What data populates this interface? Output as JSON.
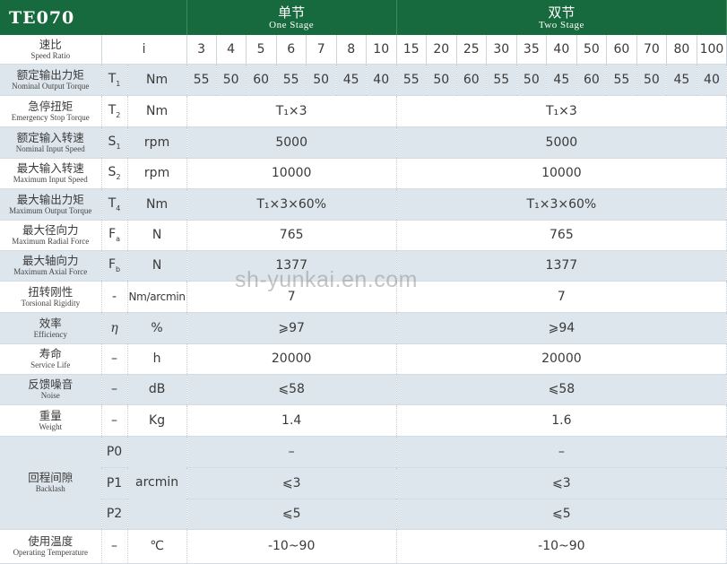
{
  "header": {
    "model": "TE070",
    "one_stage_zh": "单节",
    "one_stage_en": "One Stage",
    "two_stage_zh": "双节",
    "two_stage_en": "Two Stage"
  },
  "rows": {
    "ratio": {
      "zh": "速比",
      "en": "Speed Ratio",
      "sym": "i",
      "values": [
        "3",
        "4",
        "5",
        "6",
        "7",
        "8",
        "10",
        "15",
        "20",
        "25",
        "30",
        "35",
        "40",
        "50",
        "60",
        "70",
        "80",
        "100"
      ]
    },
    "rated_torque": {
      "zh": "额定输出力矩",
      "en": "Nominal Output Torque",
      "sym": "T",
      "sub": "1",
      "unit": "Nm",
      "values": [
        "55",
        "50",
        "60",
        "55",
        "50",
        "45",
        "40",
        "55",
        "50",
        "60",
        "55",
        "50",
        "45",
        "60",
        "55",
        "50",
        "45",
        "40"
      ]
    },
    "emergency": {
      "zh": "急停扭矩",
      "en": "Emergency Stop Torque",
      "sym": "T",
      "sub": "2",
      "unit": "Nm",
      "one": "T₁×3",
      "two": "T₁×3"
    },
    "rated_speed": {
      "zh": "额定输入转速",
      "en": "Nominal Input Speed",
      "sym": "S",
      "sub": "1",
      "unit": "rpm",
      "one": "5000",
      "two": "5000"
    },
    "max_speed": {
      "zh": "最大输入转速",
      "en": "Maximum Input Speed",
      "sym": "S",
      "sub": "2",
      "unit": "rpm",
      "one": "10000",
      "two": "10000"
    },
    "max_torque": {
      "zh": "最大输出力矩",
      "en": "Maximum Output Torque",
      "sym": "T",
      "sub": "4",
      "unit": "Nm",
      "one": "T₁×3×60%",
      "two": "T₁×3×60%"
    },
    "radial": {
      "zh": "最大径向力",
      "en": "Maximum Radial Force",
      "sym": "F",
      "sub": "a",
      "unit": "N",
      "one": "765",
      "two": "765"
    },
    "axial": {
      "zh": "最大轴向力",
      "en": "Maximum Axial Force",
      "sym": "F",
      "sub": "b",
      "unit": "N",
      "one": "1377",
      "two": "1377"
    },
    "rigidity": {
      "zh": "扭转刚性",
      "en": "Torsional Rigidity",
      "sym": "-",
      "unit": "Nm/arcmin",
      "one": "7",
      "two": "7"
    },
    "efficiency": {
      "zh": "效率",
      "en": "Efficiency",
      "sym": "η",
      "unit": "%",
      "one": "⩾97",
      "two": "⩾94"
    },
    "life": {
      "zh": "寿命",
      "en": "Service Life",
      "sym": "–",
      "unit": "h",
      "one": "20000",
      "two": "20000"
    },
    "noise": {
      "zh": "反馈噪音",
      "en": "Noise",
      "sym": "–",
      "unit": "dB",
      "one": "⩽58",
      "two": "⩽58"
    },
    "weight": {
      "zh": "重量",
      "en": "Weight",
      "sym": "–",
      "unit": "Kg",
      "one": "1.4",
      "two": "1.6"
    },
    "backlash": {
      "zh": "回程间隙",
      "en": "Backlash",
      "unit": "arcmin",
      "p0": {
        "label": "P0",
        "one": "–",
        "two": "–"
      },
      "p1": {
        "label": "P1",
        "one": "⩽3",
        "two": "⩽3"
      },
      "p2": {
        "label": "P2",
        "one": "⩽5",
        "two": "⩽5"
      }
    },
    "temperature": {
      "zh": "使用温度",
      "en": "Operating Temperature",
      "sym": "–",
      "unit": "℃",
      "one": "-10~90",
      "two": "-10~90"
    }
  },
  "watermark": "sh-yunkai.en.com"
}
